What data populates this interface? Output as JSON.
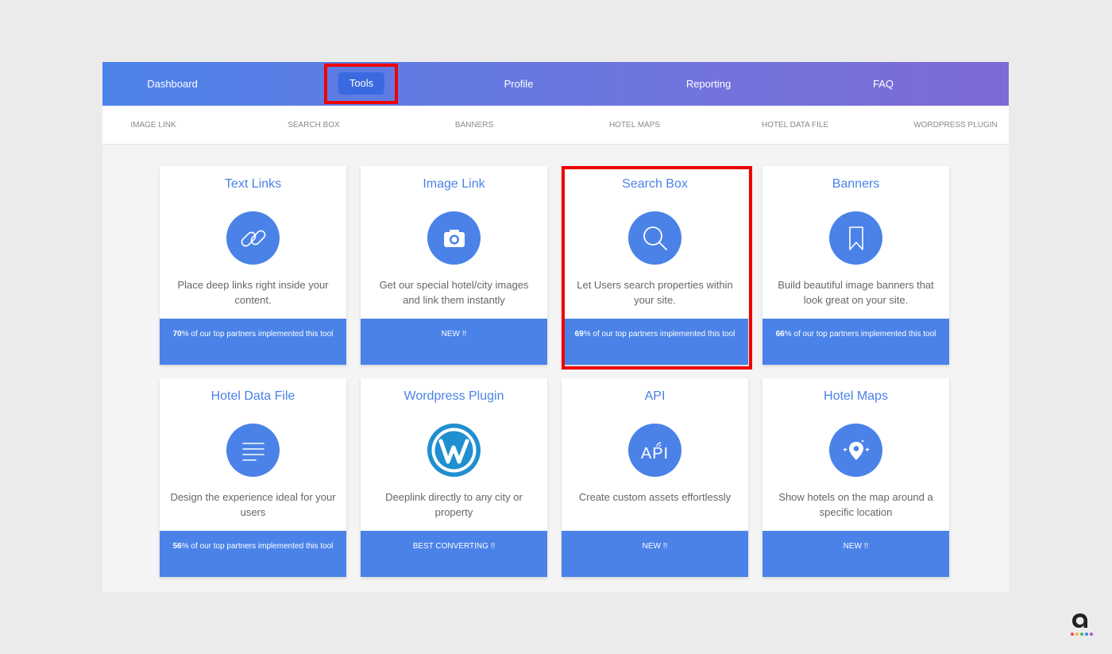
{
  "topnav": {
    "items": [
      {
        "label": "Dashboard",
        "active": false
      },
      {
        "label": "Tools",
        "active": true
      },
      {
        "label": "Profile",
        "active": false
      },
      {
        "label": "Reporting",
        "active": false
      },
      {
        "label": "FAQ",
        "active": false
      }
    ]
  },
  "subnav": {
    "items": [
      "IMAGE LINK",
      "SEARCH BOX",
      "BANNERS",
      "HOTEL MAPS",
      "HOTEL DATA FILE",
      "WORDPRESS PLUGIN"
    ]
  },
  "cards": [
    {
      "title": "Text Links",
      "icon": "link-icon",
      "description": "Place deep links right inside your content.",
      "footer_strong": "70",
      "footer_text": "% of our top partners implemented this tool"
    },
    {
      "title": "Image Link",
      "icon": "camera-icon",
      "description": "Get our special hotel/city images and link them instantly",
      "footer_strong": "",
      "footer_text": "NEW !!"
    },
    {
      "title": "Search Box",
      "icon": "search-icon",
      "description": "Let Users search properties within your site.",
      "footer_strong": "69",
      "footer_text": "% of our top partners implemented this tool"
    },
    {
      "title": "Banners",
      "icon": "bookmark-icon",
      "description": "Build beautiful image banners that look great on your site.",
      "footer_strong": "66",
      "footer_text": "% of our top partners implemented this tool"
    },
    {
      "title": "Hotel Data File",
      "icon": "lines-icon",
      "description": "Design the experience ideal for your users",
      "footer_strong": "56",
      "footer_text": "% of our top partners implemented this tool"
    },
    {
      "title": "Wordpress Plugin",
      "icon": "wordpress-icon",
      "description": "Deeplink directly to any city or property",
      "footer_strong": "",
      "footer_text": "BEST CONVERTING !!"
    },
    {
      "title": "API",
      "icon": "api-icon",
      "description": "Create custom assets effortlessly",
      "footer_strong": "",
      "footer_text": "NEW !!"
    },
    {
      "title": "Hotel Maps",
      "icon": "map-pin-icon",
      "description": "Show hotels on the map around a specific location",
      "footer_strong": "",
      "footer_text": "NEW !!"
    }
  ],
  "colors": {
    "accent": "#4a82e8",
    "highlight": "#ef0000",
    "nav_gradient_start": "#4d82e9",
    "nav_gradient_end": "#7d6bd6"
  },
  "api_icon_text": "API"
}
